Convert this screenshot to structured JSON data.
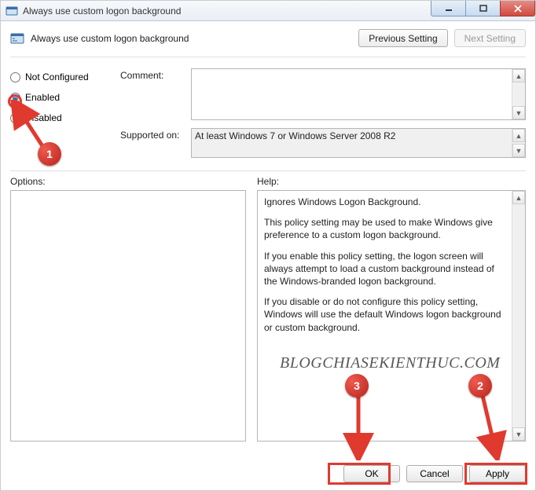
{
  "window": {
    "title": "Always use custom logon background"
  },
  "header": {
    "title": "Always use custom logon background",
    "prev_label": "Previous Setting",
    "next_label": "Next Setting"
  },
  "radios": {
    "not_configured": "Not Configured",
    "enabled": "Enabled",
    "disabled": "Disabled",
    "selected": "enabled"
  },
  "fields": {
    "comment_label": "Comment:",
    "comment_value": "",
    "supported_label": "Supported on:",
    "supported_value": "At least Windows 7 or Windows Server 2008 R2"
  },
  "panes": {
    "options_label": "Options:",
    "help_label": "Help:"
  },
  "help": {
    "p1": "Ignores Windows Logon Background.",
    "p2": "This policy setting may be used to make Windows give preference to a custom logon background.",
    "p3": "If you enable this policy setting, the logon screen will always attempt to load a custom background instead of the Windows-branded logon background.",
    "p4": "If you disable or do not configure this policy setting, Windows will use the default Windows logon background or custom background."
  },
  "footer": {
    "ok": "OK",
    "cancel": "Cancel",
    "apply": "Apply"
  },
  "annotations": {
    "n1": "1",
    "n2": "2",
    "n3": "3",
    "watermark": "BLOGCHIASEKIENTHUC.COM"
  }
}
